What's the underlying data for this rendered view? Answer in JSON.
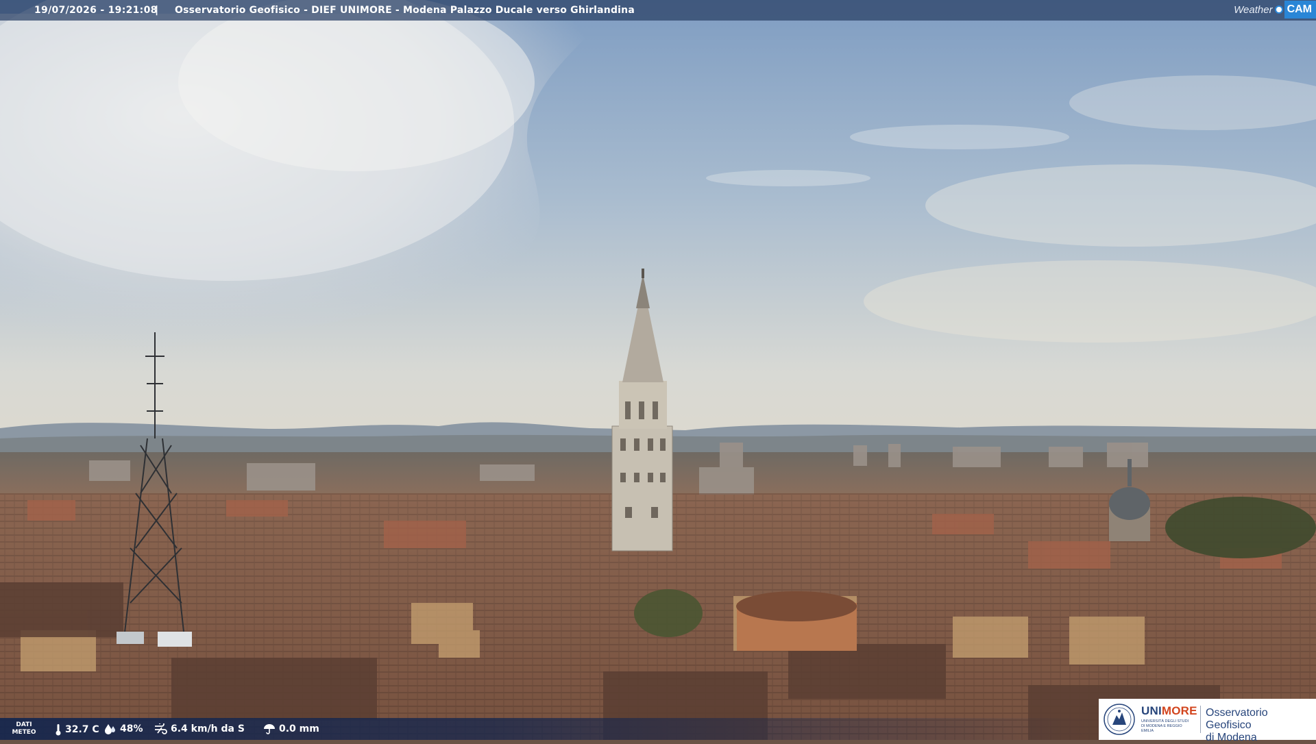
{
  "overlay": {
    "timestamp": "19/07/2026 - 19:21:08",
    "separator": "|",
    "title": "Osservatorio Geofisico - DIEF UNIMORE - Modena Palazzo Ducale verso Ghirlandina",
    "brand_weather": "Weather",
    "brand_cam": "CAM"
  },
  "meteo": {
    "label_line1": "DATI",
    "label_line2": "METEO",
    "temperature": "32.7 C",
    "humidity": "48%",
    "wind": "6.4 km/h da S",
    "rain": "0.0 mm",
    "icons": [
      "thermometer-icon",
      "humidity-drop-icon",
      "wind-icon",
      "rain-umbrella-icon"
    ]
  },
  "logo": {
    "uni_prefix": "UNI",
    "uni_suffix": "MORE",
    "uni_subtitle": "UNIVERSITÀ DEGLI STUDI DI MODENA E REGGIO EMILIA",
    "observatory_line1": "Osservatorio Geofisico",
    "observatory_line2": "di Modena"
  },
  "colors": {
    "sky_top": "#8aa3c4",
    "sky_horizon": "#d6d8d4",
    "roofs": "#7a5644",
    "tower": "#c9c2b4",
    "bar_blue": "#283e64",
    "unimore_blue": "#27457b",
    "unimore_orange": "#d2451e"
  }
}
